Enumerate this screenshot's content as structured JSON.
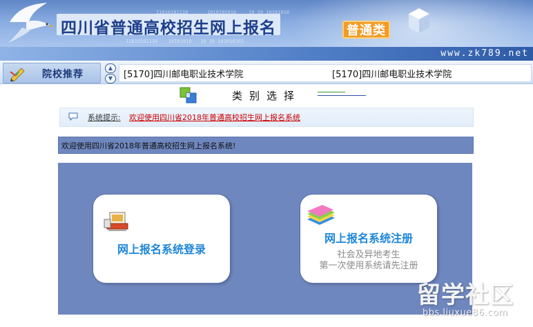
{
  "header": {
    "title": "四川省普通高校招生网上报名",
    "subtitle": "普通类",
    "site_url": "www.zk789.net",
    "binary_lines": [
      "11010101110",
      "1010101010",
      "10 10 10101010",
      "11010101110",
      "10101010",
      "10 10 101010101"
    ]
  },
  "recommend": {
    "label": "院校推荐",
    "up_arrow": "▲",
    "down_arrow": "▼",
    "schools": [
      "[5170]四川邮电职业技术学院",
      "[5170]四川邮电职业技术学院"
    ]
  },
  "category": {
    "title": "类别选择"
  },
  "notice": {
    "prefix": "系统提示:",
    "message": "欢迎使用四川省2018年普通高校招生网上报名系统"
  },
  "welcome": {
    "text": "欢迎使用四川省2018年普通高校招生网上报名系统!"
  },
  "cards": {
    "login": {
      "title": "网上报名系统登录"
    },
    "register": {
      "title": "网上报名系统注册",
      "sub_line1": "社会及异地考生",
      "sub_line2": "第一次使用系统请先注册"
    }
  },
  "watermark": {
    "main": "留学社区",
    "url": "bbs.liuxue86.com"
  },
  "colors": {
    "banner_blue": "#5f86c6",
    "panel_blue": "#6f87bf",
    "title_blue": "#1d86d9",
    "notice_red": "#cc0000",
    "accent_orange": "#f39b26"
  }
}
